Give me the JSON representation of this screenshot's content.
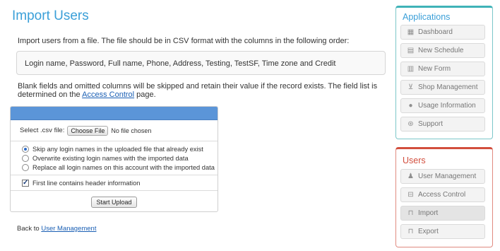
{
  "page": {
    "title": "Import Users",
    "intro": "Import users from a file. The file should be in CSV format with the columns in the following order:",
    "columns": "Login name, Password, Full name, Phone, Address, Testing, TestSF, Time zone and Credit",
    "blank_note_before": "Blank fields and omitted columns will be skipped and retain their value if the record exists. The field list is determined on the ",
    "blank_note_link": "Access Control",
    "blank_note_after": " page."
  },
  "upload": {
    "file_label": "Select .csv file:",
    "file_button": "Choose File",
    "file_status": "No file chosen",
    "options": [
      {
        "label": "Skip any login names in the uploaded file that already exist",
        "selected": true
      },
      {
        "label": "Overwrite existing login names with the imported data",
        "selected": false
      },
      {
        "label": "Replace all login names on this account with the imported data",
        "selected": false
      }
    ],
    "header_checkbox_label": "First line contains header information",
    "header_checkbox_checked": true,
    "start_button": "Start Upload"
  },
  "footer": {
    "back_prefix": "Back to ",
    "back_link": "User Management"
  },
  "applications": {
    "title": "Applications",
    "items": [
      {
        "label": "Dashboard",
        "icon": "grid-icon"
      },
      {
        "label": "New Schedule",
        "icon": "calendar-icon"
      },
      {
        "label": "New Form",
        "icon": "form-icon"
      },
      {
        "label": "Shop Management",
        "icon": "cart-icon"
      },
      {
        "label": "Usage Information",
        "icon": "info-icon"
      },
      {
        "label": "Support",
        "icon": "lifebuoy-icon"
      }
    ]
  },
  "users": {
    "title": "Users",
    "items": [
      {
        "label": "User Management",
        "icon": "user-icon"
      },
      {
        "label": "Access Control",
        "icon": "lock-icon"
      },
      {
        "label": "Import",
        "icon": "inbox-import-icon"
      },
      {
        "label": "Export",
        "icon": "inbox-export-icon"
      }
    ]
  },
  "colors": {
    "title_blue": "#3a9fd8",
    "apps_accent": "#3fb3b8",
    "users_accent": "#d24e3d",
    "panel_header": "#5b95d8"
  }
}
